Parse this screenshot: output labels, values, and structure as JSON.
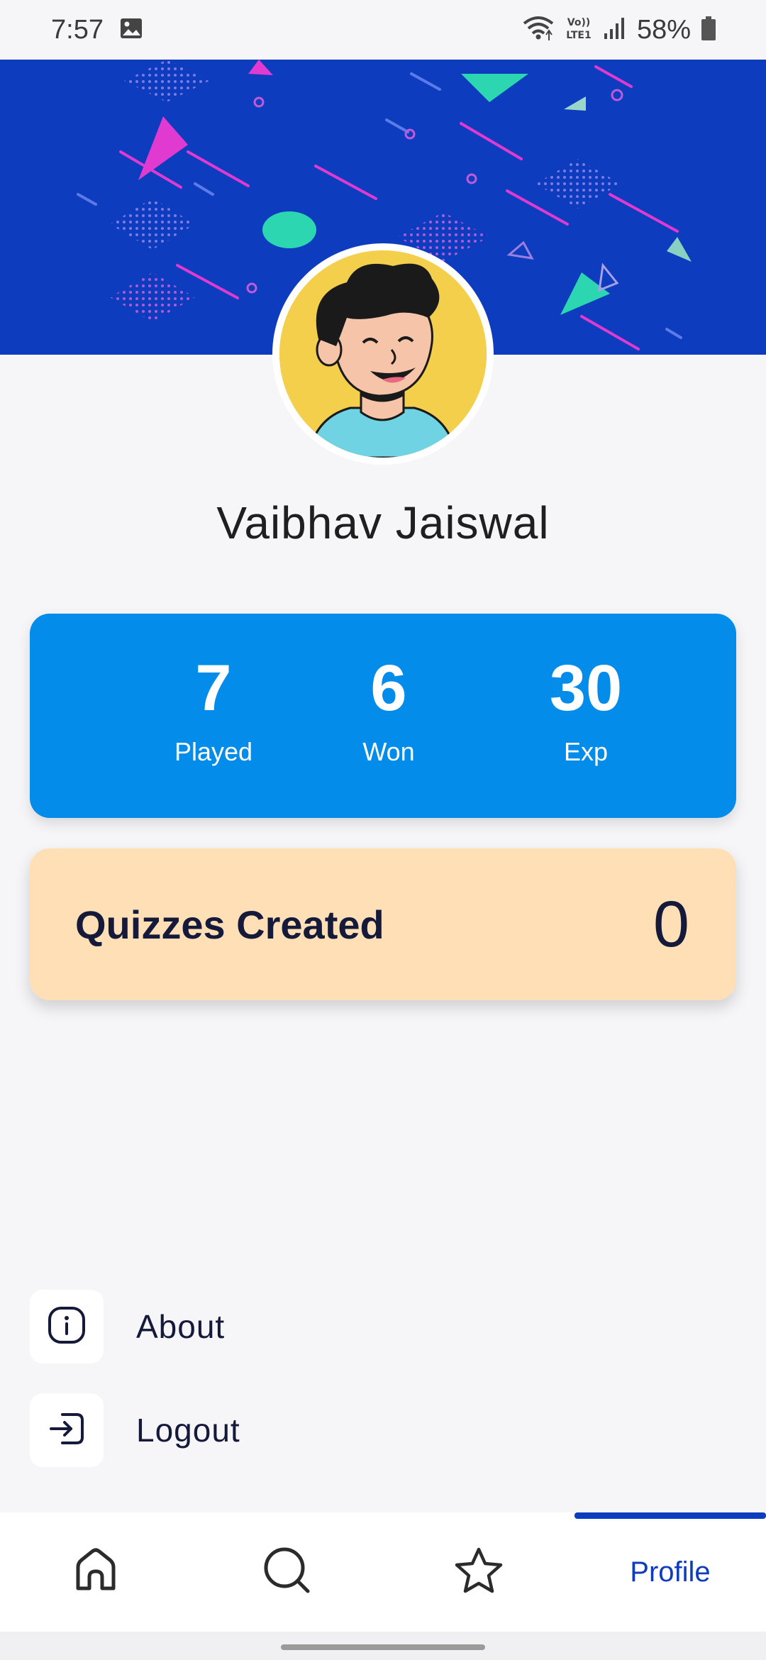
{
  "status_bar": {
    "time": "7:57",
    "network_label": "Vo))\nLTE1",
    "battery": "58%",
    "icons": [
      "image-icon",
      "wifi-icon",
      "lte-icon",
      "signal-icon",
      "battery-icon"
    ]
  },
  "profile": {
    "name": "Vaibhav Jaiswal"
  },
  "stats": {
    "played": {
      "value": "7",
      "label": "Played"
    },
    "won": {
      "value": "6",
      "label": "Won"
    },
    "exp": {
      "value": "30",
      "label": "Exp"
    }
  },
  "quizzes": {
    "label": "Quizzes Created",
    "count": "0"
  },
  "menu": {
    "about": {
      "label": "About",
      "icon": "info-icon"
    },
    "logout": {
      "label": "Logout",
      "icon": "logout-icon"
    }
  },
  "bottom_nav": {
    "items": [
      {
        "icon": "home-icon"
      },
      {
        "icon": "search-icon"
      },
      {
        "icon": "star-icon"
      },
      {
        "label": "Profile",
        "active": true
      }
    ]
  },
  "colors": {
    "banner": "#0d3cbf",
    "stats_card": "#038ce9",
    "quizzes_card": "#ffe0b6",
    "nav_active": "#0d3cbf"
  }
}
